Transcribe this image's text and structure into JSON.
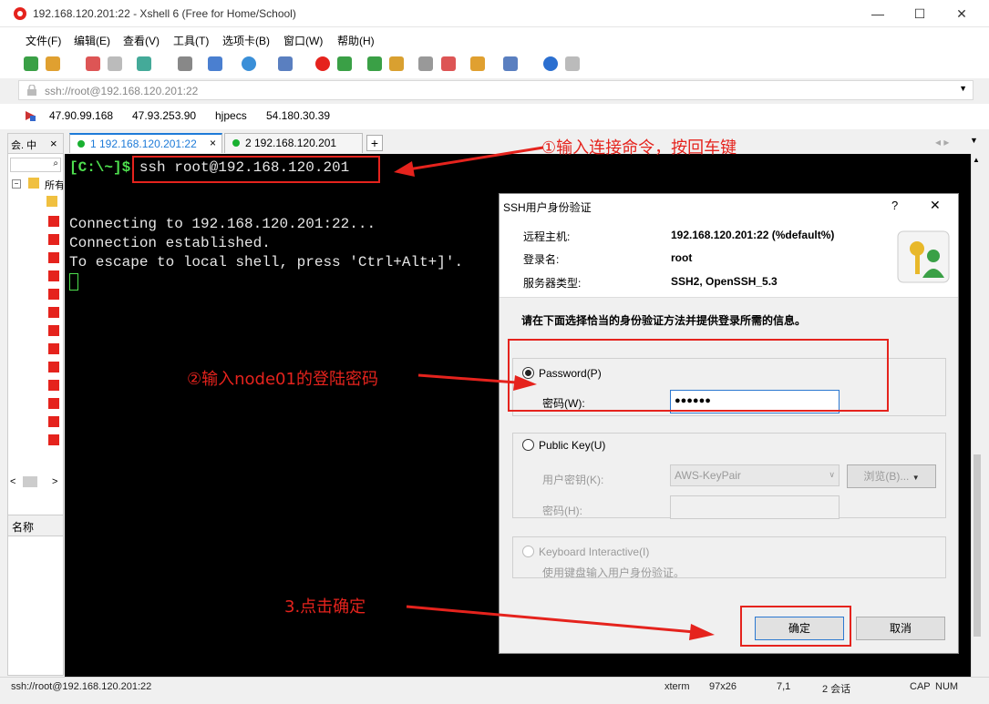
{
  "window": {
    "title": "192.168.120.201:22 - Xshell 6 (Free for Home/School)",
    "minimize": "—",
    "maximize": "☐",
    "close": "✕"
  },
  "menu": [
    "文件(F)",
    "编辑(E)",
    "查看(V)",
    "工具(T)",
    "选项卡(B)",
    "窗口(W)",
    "帮助(H)"
  ],
  "address": {
    "value": "ssh://root@192.168.120.201:22"
  },
  "quick_links": [
    "47.90.99.168",
    "47.93.253.90",
    "hjpecs",
    "54.180.30.39"
  ],
  "sidebar": {
    "header": "会. 中",
    "close": "×",
    "root_label": "所有",
    "name_header": "名称"
  },
  "tabs": [
    {
      "label": "1 192.168.120.201:22",
      "close": "×"
    },
    {
      "label": "2 192.168.120.201"
    }
  ],
  "tab_add": "+",
  "terminal": {
    "prompt": "[C:\\~]$",
    "command": " ssh root@192.168.120.201",
    "lines": [
      "Connecting to 192.168.120.201:22...",
      "Connection established.",
      "To escape to local shell, press 'Ctrl+Alt+]'."
    ]
  },
  "annotations": {
    "a1": "①输入连接命令，按回车键",
    "a2": "②输入node01的登陆密码",
    "a3": "3.点击确定"
  },
  "dialog": {
    "title": "SSH用户身份验证",
    "help": "?",
    "close": "✕",
    "host_label": "远程主机:",
    "host_value": "192.168.120.201:22 (%default%)",
    "login_label": "登录名:",
    "login_value": "root",
    "server_label": "服务器类型:",
    "server_value": "SSH2, OpenSSH_5.3",
    "instruction": "请在下面选择恰当的身份验证方法并提供登录所需的信息。",
    "password_option": "Password(P)",
    "password_label": "密码(W):",
    "password_value": "●●●●●●",
    "pubkey_option": "Public Key(U)",
    "userkey_label": "用户密钥(K):",
    "userkey_value": "AWS-KeyPair",
    "browse": "浏览(B)...",
    "passphrase_label": "密码(H):",
    "kbd_option": "Keyboard Interactive(I)",
    "kbd_desc": "使用键盘输入用户身份验证。",
    "ok": "确定",
    "cancel": "取消"
  },
  "status": {
    "connection": "ssh://root@192.168.120.201:22",
    "term": "xterm",
    "size": "97x26",
    "pos": "7,1",
    "sessions": "2 会话",
    "caps": "CAP",
    "num": "NUM"
  },
  "colors": {
    "accent": "#1e7bd8",
    "annotation": "#e5231d",
    "terminal_bg": "#000000"
  }
}
